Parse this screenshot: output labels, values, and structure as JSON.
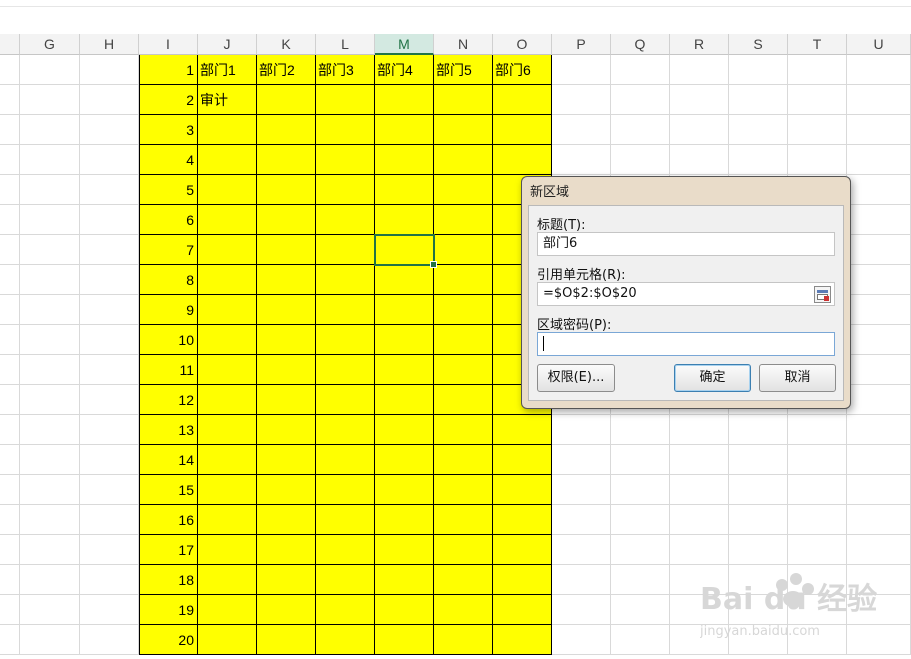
{
  "columns": [
    "G",
    "H",
    "I",
    "J",
    "K",
    "L",
    "M",
    "N",
    "O",
    "P",
    "Q",
    "R",
    "S",
    "T",
    "U"
  ],
  "selected_column": "M",
  "rows": [
    "1",
    "2",
    "3",
    "4",
    "5",
    "6",
    "7",
    "8",
    "9",
    "10",
    "11",
    "12",
    "13",
    "14",
    "15",
    "16",
    "17",
    "18",
    "19",
    "20"
  ],
  "cells": {
    "row1": [
      "部门1",
      "部门2",
      "部门3",
      "部门4",
      "部门5",
      "部门6"
    ],
    "row2": [
      "审计",
      "",
      "",
      "",
      "",
      ""
    ]
  },
  "colors": {
    "fill": "#ffff00",
    "selection": "#217346"
  },
  "dialog": {
    "title": "新区域",
    "title_label": "标题(T):",
    "title_value": "部门6",
    "ref_label": "引用单元格(R):",
    "ref_value": "=$O$2:$O$20",
    "pwd_label": "区域密码(P):",
    "pwd_value": "",
    "perm_button": "权限(E)...",
    "ok_button": "确定",
    "cancel_button": "取消"
  },
  "watermark": {
    "brand": "Bai du 经验",
    "url": "jingyan.baidu.com"
  }
}
